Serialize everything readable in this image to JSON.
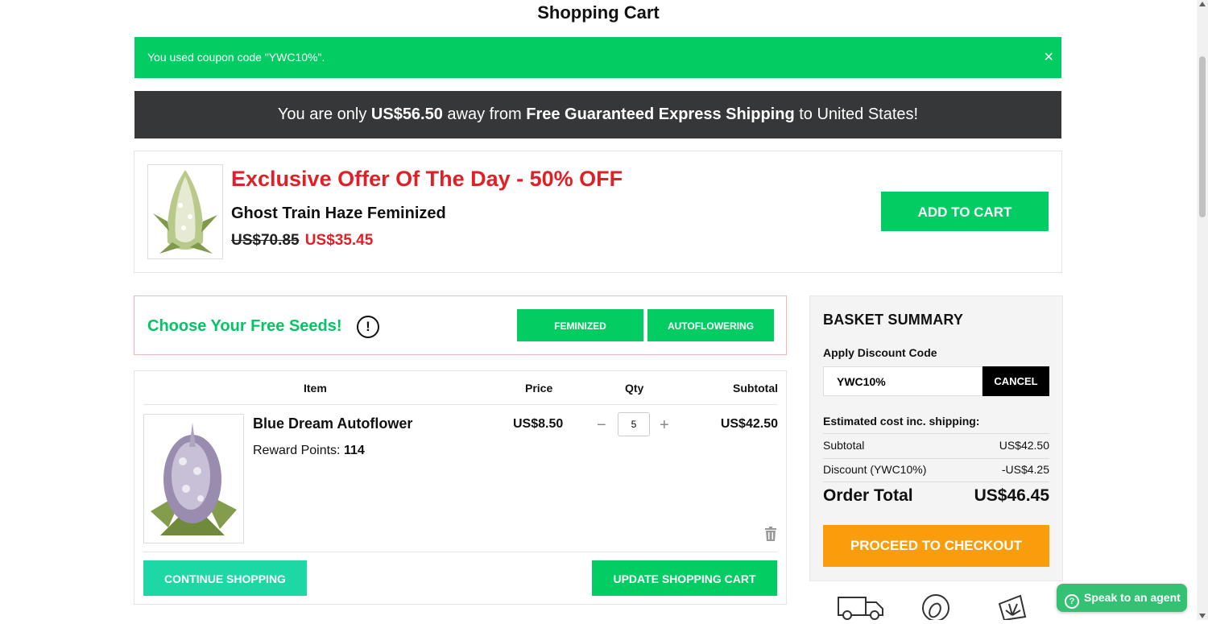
{
  "page": {
    "title": "Shopping Cart"
  },
  "coupon_notice": {
    "message": "You used coupon code \"YWC10%\".",
    "close_symbol": "×"
  },
  "shipping_bar": {
    "prefix": "You are only ",
    "amount": "US$56.50",
    "middle": " away from ",
    "highlight": "Free Guaranteed Express Shipping",
    "suffix": " to United States!"
  },
  "offer": {
    "headline": "Exclusive Offer Of The Day - 50% OFF",
    "product_name": "Ghost Train Haze Feminized",
    "old_price": "US$70.85",
    "new_price": "US$35.45",
    "button_label": "ADD TO CART"
  },
  "free_seeds": {
    "label": "Choose Your Free Seeds!",
    "info_symbol": "!",
    "tabs": [
      "FEMINIZED",
      "AUTOFLOWERING"
    ]
  },
  "cart": {
    "headers": {
      "item": "Item",
      "price": "Price",
      "qty": "Qty",
      "subtotal": "Subtotal"
    },
    "items": [
      {
        "name": "Blue Dream Autoflower",
        "reward_label": "Reward Points: ",
        "reward_points": "114",
        "price": "US$8.50",
        "qty": "5",
        "subtotal": "US$42.50"
      }
    ],
    "qty_minus": "−",
    "qty_plus": "+",
    "continue_label": "CONTINUE SHOPPING",
    "update_label": "UPDATE SHOPPING CART"
  },
  "summary": {
    "title": "BASKET SUMMARY",
    "discount_label": "Apply Discount Code",
    "discount_value": "YWC10%",
    "cancel_label": "CANCEL",
    "estimate_label": "Estimated cost inc. shipping:",
    "subtotal_label": "Subtotal",
    "subtotal_value": "US$42.50",
    "discount_row_label": "Discount (YWC10%)",
    "discount_row_value": "-US$4.25",
    "total_label": "Order Total",
    "total_value": "US$46.45",
    "checkout_label": "PROCEED TO CHECKOUT"
  },
  "trust_icons": [
    "delivery-truck-icon",
    "seed-badge-icon",
    "cannabis-leaf-icon"
  ],
  "agent_button": {
    "label": "Speak to an agent",
    "icon_symbol": "?"
  },
  "colors": {
    "green": "#03cc63",
    "dark_bar": "#363738",
    "red": "#e01f26",
    "orange": "#f99d0c",
    "teal": "#1dd7a5"
  }
}
